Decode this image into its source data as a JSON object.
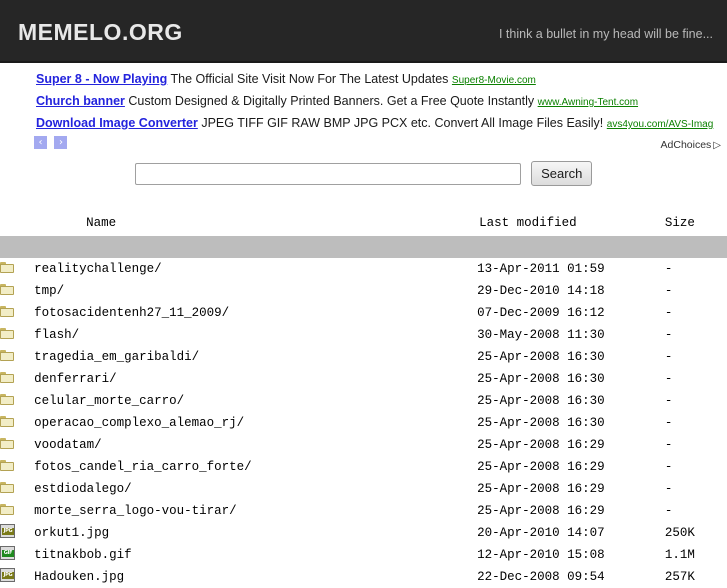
{
  "header": {
    "title": "MEMELO.ORG",
    "tagline": "I think a bullet in my head will be fine..."
  },
  "ads": {
    "items": [
      {
        "title": "Super 8 - Now Playing",
        "description": "The Official Site Visit Now For The Latest Updates",
        "url": "Super8-Movie.com"
      },
      {
        "title": "Church banner",
        "description": "Custom Designed & Digitally Printed Banners. Get a Free Quote Instantly",
        "url": "www.Awning-Tent.com"
      },
      {
        "title": "Download Image Converter",
        "description": "JPEG TIFF GIF RAW BMP JPG PCX etc. Convert All Image Files Easily!",
        "url": "avs4you.com/AVS-Imag"
      }
    ],
    "prev_label": "‹",
    "next_label": "›",
    "adchoices_label": "AdChoices",
    "adchoices_icon": "▷"
  },
  "search": {
    "value": "",
    "placeholder": "",
    "button_label": "Search"
  },
  "listing": {
    "columns": {
      "name": "Name",
      "last_modified": "Last modified",
      "size": "Size"
    },
    "rows": [
      {
        "icon": "folder-icon",
        "type": "folder",
        "name": "realitychallenge/",
        "last_modified": "13-Apr-2011 01:59",
        "size": "-"
      },
      {
        "icon": "folder-icon",
        "type": "folder",
        "name": "tmp/",
        "last_modified": "29-Dec-2010 14:18",
        "size": "-"
      },
      {
        "icon": "folder-icon",
        "type": "folder",
        "name": "fotosacidentenh27_11_2009/",
        "last_modified": "07-Dec-2009 16:12",
        "size": "-"
      },
      {
        "icon": "folder-icon",
        "type": "folder",
        "name": "flash/",
        "last_modified": "30-May-2008 11:30",
        "size": "-"
      },
      {
        "icon": "folder-icon",
        "type": "folder",
        "name": "tragedia_em_garibaldi/",
        "last_modified": "25-Apr-2008 16:30",
        "size": "-"
      },
      {
        "icon": "folder-icon",
        "type": "folder",
        "name": "denferrari/",
        "last_modified": "25-Apr-2008 16:30",
        "size": "-"
      },
      {
        "icon": "folder-icon",
        "type": "folder",
        "name": "celular_morte_carro/",
        "last_modified": "25-Apr-2008 16:30",
        "size": "-"
      },
      {
        "icon": "folder-icon",
        "type": "folder",
        "name": "operacao_complexo_alemao_rj/",
        "last_modified": "25-Apr-2008 16:30",
        "size": "-"
      },
      {
        "icon": "folder-icon",
        "type": "folder",
        "name": "voodatam/",
        "last_modified": "25-Apr-2008 16:29",
        "size": "-"
      },
      {
        "icon": "folder-icon",
        "type": "folder",
        "name": "fotos_candel_ria_carro_forte/",
        "last_modified": "25-Apr-2008 16:29",
        "size": "-"
      },
      {
        "icon": "folder-icon",
        "type": "folder",
        "name": "estdiodalego/",
        "last_modified": "25-Apr-2008 16:29",
        "size": "-"
      },
      {
        "icon": "folder-icon",
        "type": "folder",
        "name": "morte_serra_logo-vou-tirar/",
        "last_modified": "25-Apr-2008 16:29",
        "size": "-"
      },
      {
        "icon": "jpg-file-icon",
        "type": "jpg",
        "badge": "JPG",
        "name": "orkut1.jpg",
        "last_modified": "20-Apr-2010 14:07",
        "size": "250K"
      },
      {
        "icon": "gif-file-icon",
        "type": "gif",
        "badge": "GIF",
        "name": "titnakbob.gif",
        "last_modified": "12-Apr-2010 15:08",
        "size": "1.1M"
      },
      {
        "icon": "jpg-file-icon",
        "type": "jpg",
        "badge": "JPG",
        "name": "Hadouken.jpg",
        "last_modified": "22-Dec-2008 09:54",
        "size": "257K"
      }
    ]
  },
  "colors": {
    "header_bg": "#262626",
    "ad_link": "#2323dd",
    "ad_url": "#0b8000",
    "folder_icon": "#f2edc6",
    "gif_badge": "#1f8a1f",
    "jpg_badge": "#7a7a18"
  }
}
